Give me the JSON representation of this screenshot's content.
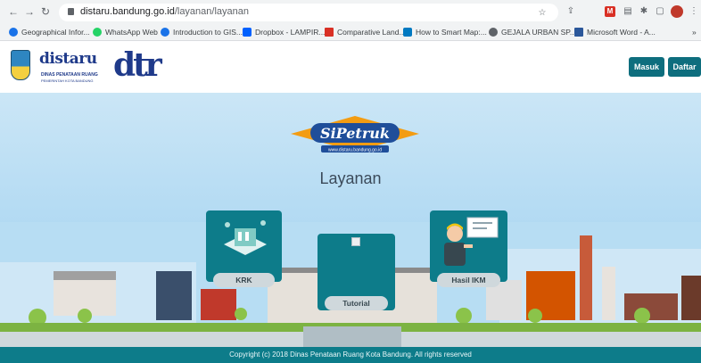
{
  "browser": {
    "url_host": "distaru.bandung.go.id",
    "url_path": "/layanan/layanan",
    "bookmarks": [
      {
        "label": "Geographical Infor...",
        "color": "#1a73e8"
      },
      {
        "label": "WhatsApp Web",
        "color": "#25d366"
      },
      {
        "label": "Introduction to GIS...",
        "color": "#1a73e8"
      },
      {
        "label": "Dropbox - LAMPIR...",
        "color": "#0061fe"
      },
      {
        "label": "Comparative Land...",
        "color": "#d93025"
      },
      {
        "label": "How to Smart Map:...",
        "color": "#0079c1"
      },
      {
        "label": "GEJALA URBAN SP...",
        "color": "#5f6368"
      },
      {
        "label": "Microsoft Word - A...",
        "color": "#2b579a"
      }
    ],
    "bookmark_overflow": "»"
  },
  "header": {
    "brand_word": "distaru",
    "brand_sub1": "DINAS PENATAAN RUANG",
    "brand_sub2": "PEMERINTAH KOTA BANDUNG",
    "brand_mark": "dtr",
    "login_label": "Masuk",
    "register_label": "Daftar"
  },
  "main": {
    "logo_text": "SiPetruk",
    "logo_url": "www.distaru.bandung.go.id",
    "title": "Layanan",
    "cards": [
      {
        "label": "KRK"
      },
      {
        "label": "Tutorial"
      },
      {
        "label": "Hasil IKM"
      }
    ]
  },
  "footer": {
    "copyright": "Copyright (c) 2018 Dinas Penataan Ruang Kota Bandung. All rights reserved"
  },
  "colors": {
    "teal": "#0d7c8a",
    "sky": "#aed8f2",
    "brand_blue": "#1f3a8a"
  }
}
